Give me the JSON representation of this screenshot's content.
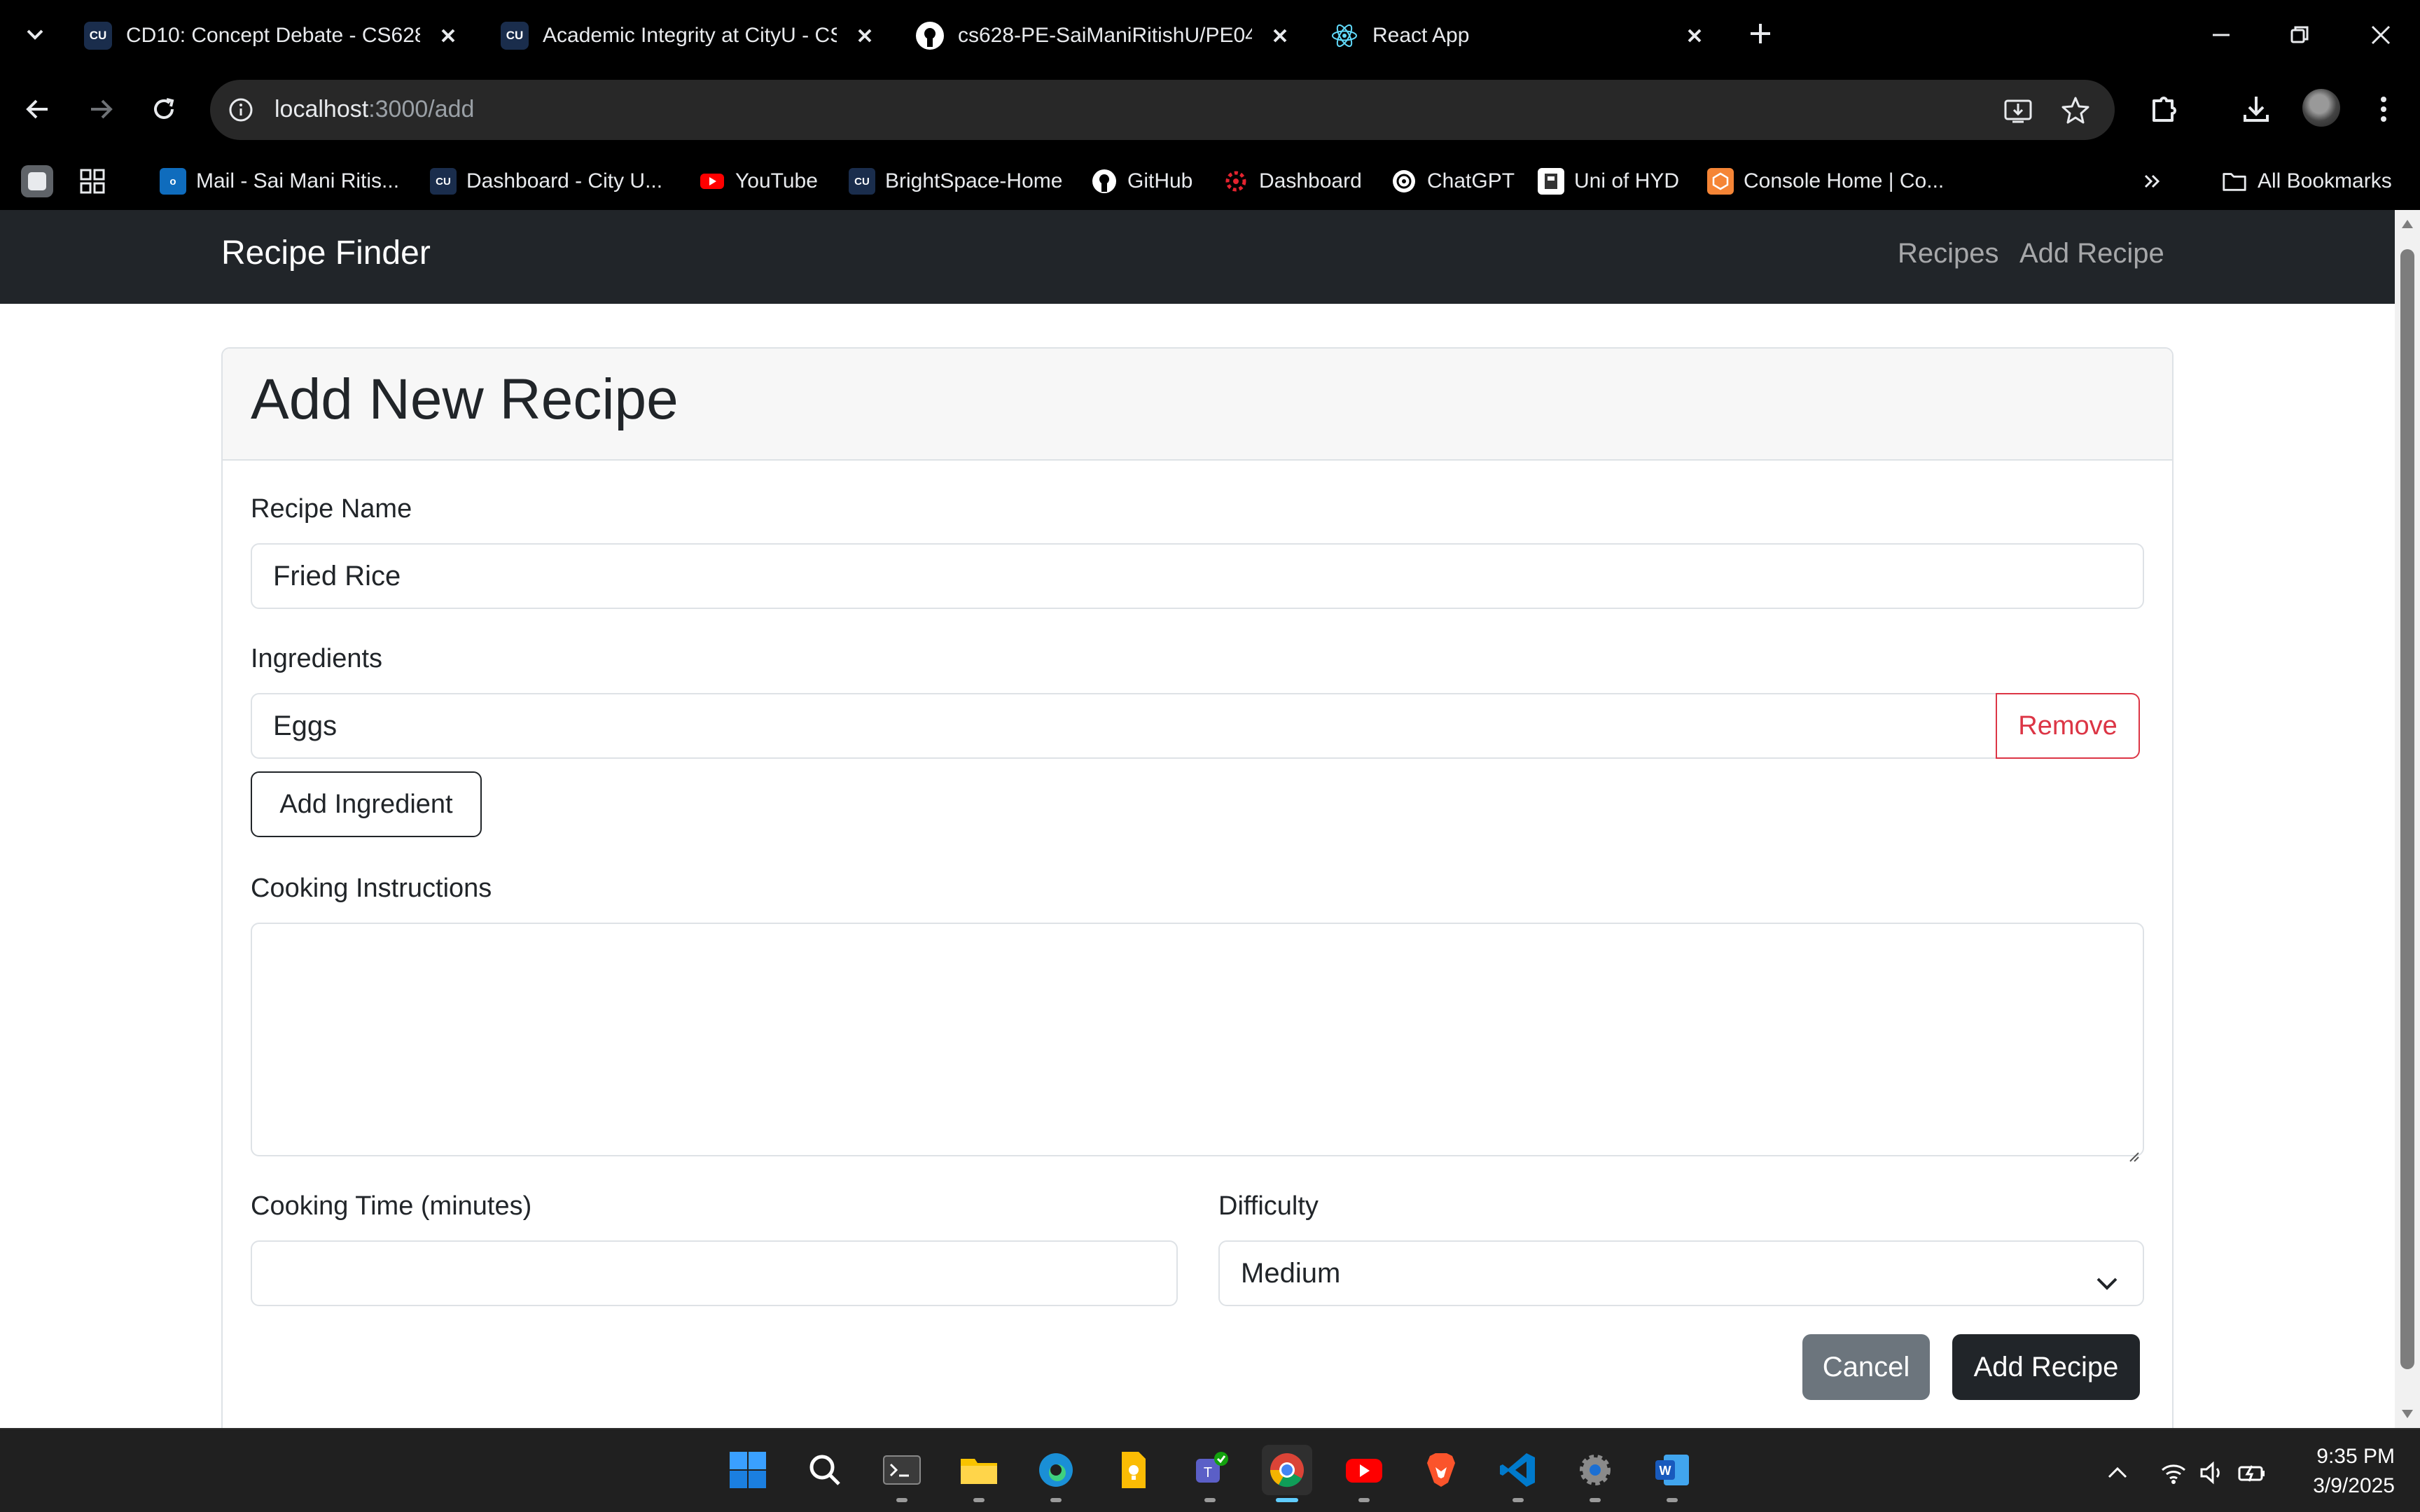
{
  "browser": {
    "tabs": [
      {
        "title": "CD10: Concept Debate - CS628",
        "favicon": "cityu-icon"
      },
      {
        "title": "Academic Integrity at CityU - CS",
        "favicon": "cityu-icon"
      },
      {
        "title": "cs628-PE-SaiManiRitishU/PE04",
        "favicon": "github-icon"
      },
      {
        "title": "React App",
        "favicon": "react-icon"
      }
    ],
    "address": {
      "host": "localhost",
      "path": ":3000/add"
    },
    "bookmarks": [
      {
        "label": "Mail - Sai Mani Ritis...",
        "icon": "outlook-icon"
      },
      {
        "label": "Dashboard - City U...",
        "icon": "cityu-icon"
      },
      {
        "label": "YouTube",
        "icon": "youtube-icon"
      },
      {
        "label": "BrightSpace-Home",
        "icon": "cityu-icon"
      },
      {
        "label": "GitHub",
        "icon": "github-icon"
      },
      {
        "label": "Dashboard",
        "icon": "canvas-icon"
      },
      {
        "label": "ChatGPT",
        "icon": "openai-icon"
      },
      {
        "label": "Uni of HYD",
        "icon": "uoh-icon"
      },
      {
        "label": "Console Home | Co...",
        "icon": "aws-icon"
      }
    ],
    "all_bookmarks": "All Bookmarks"
  },
  "app": {
    "brand": "Recipe Finder",
    "nav": {
      "recipes": "Recipes",
      "add_recipe": "Add Recipe"
    }
  },
  "form": {
    "title": "Add New Recipe",
    "name_label": "Recipe Name",
    "name_value": "Fried Rice",
    "ingredients_label": "Ingredients",
    "ingredients": [
      "Eggs"
    ],
    "remove_label": "Remove",
    "add_ingredient_label": "Add Ingredient",
    "instructions_label": "Cooking Instructions",
    "instructions_value": "",
    "time_label": "Cooking Time (minutes)",
    "time_value": "",
    "difficulty_label": "Difficulty",
    "difficulty_value": "Medium",
    "cancel_label": "Cancel",
    "submit_label": "Add Recipe"
  },
  "system": {
    "time": "9:35 PM",
    "date": "3/9/2025"
  },
  "colors": {
    "navbar": "#212529",
    "danger": "#dc3545",
    "secondary": "#6c757d",
    "dark": "#212529"
  }
}
